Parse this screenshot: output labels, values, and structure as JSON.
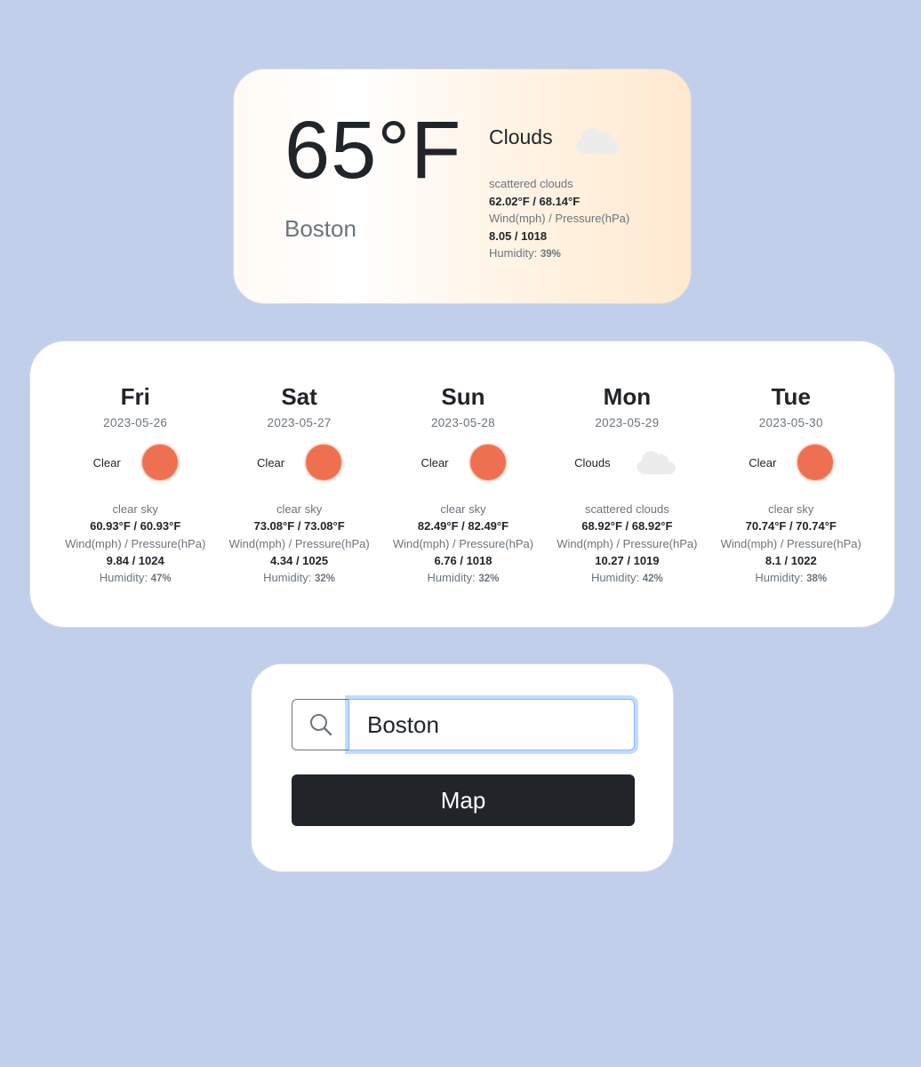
{
  "current": {
    "temp": "65°F",
    "city": "Boston",
    "main": "Clouds",
    "icon": "cloud-icon",
    "description": "scattered clouds",
    "temp_range": "62.02°F / 68.14°F",
    "wind_pressure_label": "Wind(mph) / Pressure(hPa)",
    "wind_pressure": "8.05 / 1018",
    "humidity_label": "Humidity:",
    "humidity": "39%"
  },
  "forecast": [
    {
      "day": "Fri",
      "date": "2023-05-26",
      "main": "Clear",
      "icon": "sun-icon",
      "description": "clear sky",
      "temp_range": "60.93°F / 60.93°F",
      "wind_pressure_label": "Wind(mph) / Pressure(hPa)",
      "wind_pressure": "9.84 / 1024",
      "humidity_label": "Humidity:",
      "humidity": "47%"
    },
    {
      "day": "Sat",
      "date": "2023-05-27",
      "main": "Clear",
      "icon": "sun-icon",
      "description": "clear sky",
      "temp_range": "73.08°F / 73.08°F",
      "wind_pressure_label": "Wind(mph) / Pressure(hPa)",
      "wind_pressure": "4.34 / 1025",
      "humidity_label": "Humidity:",
      "humidity": "32%"
    },
    {
      "day": "Sun",
      "date": "2023-05-28",
      "main": "Clear",
      "icon": "sun-icon",
      "description": "clear sky",
      "temp_range": "82.49°F / 82.49°F",
      "wind_pressure_label": "Wind(mph) / Pressure(hPa)",
      "wind_pressure": "6.76 / 1018",
      "humidity_label": "Humidity:",
      "humidity": "32%"
    },
    {
      "day": "Mon",
      "date": "2023-05-29",
      "main": "Clouds",
      "icon": "cloud-icon",
      "description": "scattered clouds",
      "temp_range": "68.92°F / 68.92°F",
      "wind_pressure_label": "Wind(mph) / Pressure(hPa)",
      "wind_pressure": "10.27 / 1019",
      "humidity_label": "Humidity:",
      "humidity": "42%"
    },
    {
      "day": "Tue",
      "date": "2023-05-30",
      "main": "Clear",
      "icon": "sun-icon",
      "description": "clear sky",
      "temp_range": "70.74°F / 70.74°F",
      "wind_pressure_label": "Wind(mph) / Pressure(hPa)",
      "wind_pressure": "8.1 / 1022",
      "humidity_label": "Humidity:",
      "humidity": "38%"
    }
  ],
  "search": {
    "icon": "search-icon",
    "value": "Boston",
    "map_label": "Map"
  },
  "colors": {
    "background": "#c2cfea",
    "sun": "#ef7050",
    "map_button": "#212529",
    "focus_border": "#86b7fe"
  }
}
